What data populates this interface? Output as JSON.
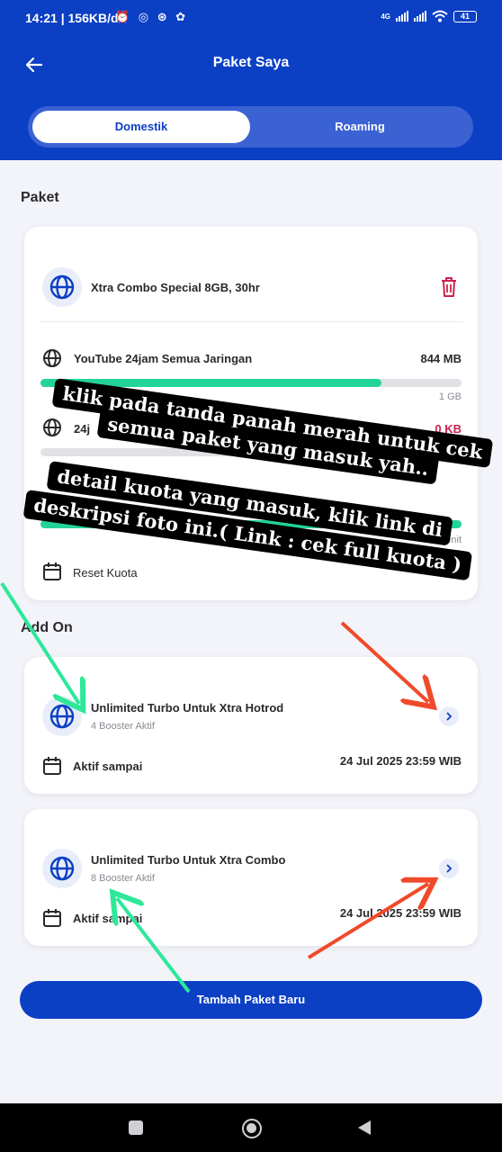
{
  "status_bar": {
    "time": "14:21 | 156KB/d",
    "network": "4G",
    "battery": "41"
  },
  "header": {
    "title": "Paket Saya",
    "tabs": [
      {
        "label": "Domestik",
        "active": true
      },
      {
        "label": "Roaming",
        "active": false
      }
    ]
  },
  "paket": {
    "section_title": "Paket",
    "package_name": "Xtra Combo Special 8GB, 30hr",
    "quotas": [
      {
        "name": "YouTube 24jam Semua Jaringan",
        "remaining": "844 MB",
        "total": "1 GB",
        "fill_fraction": 0.81
      },
      {
        "name": "24j",
        "remaining": "0 KB",
        "fill_fraction": 0.0
      },
      {
        "total": "5 Menit",
        "fill_fraction": 1.0
      }
    ],
    "reset_label": "Reset Kuota",
    "reset_value_partial": "B"
  },
  "addon": {
    "section_title": "Add On",
    "items": [
      {
        "name": "Unlimited Turbo Untuk Xtra Hotrod",
        "booster": "4 Booster Aktif",
        "active_label": "Aktif sampai",
        "active_until": "24 Jul 2025 23:59 WIB"
      },
      {
        "name": "Unlimited Turbo Untuk Xtra Combo",
        "booster": "8 Booster Aktif",
        "active_label": "Aktif sampai",
        "active_until": "24 Jul 2025 23:59 WIB"
      }
    ]
  },
  "cta_label": "Tambah Paket Baru",
  "overlay_text": {
    "line1": "klik pada tanda panah merah untuk cek",
    "line2": "semua paket yang masuk yah..",
    "line3": "detail kuota yang masuk, klik link di",
    "line4": "deskripsi foto ini.( Link : cek full kuota )"
  },
  "colors": {
    "brand_blue": "#0b3fc4",
    "progress_green": "#22d49a",
    "delete_red": "#c8234f",
    "arrow_green": "#2ee89a",
    "arrow_red": "#f04a2a"
  }
}
